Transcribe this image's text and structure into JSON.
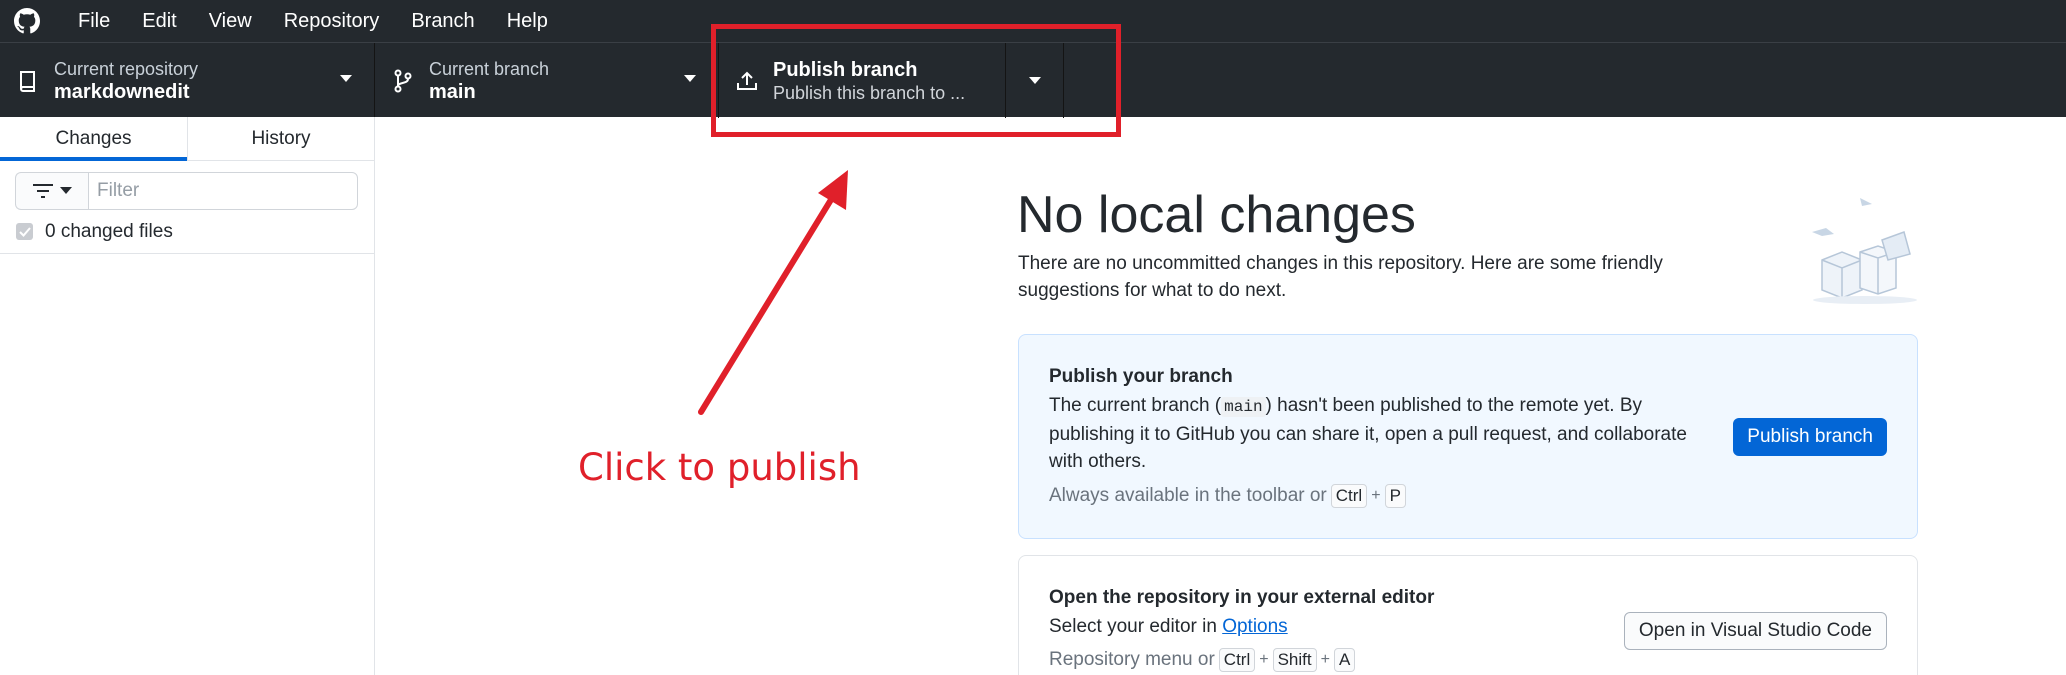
{
  "menu": {
    "items": [
      "File",
      "Edit",
      "View",
      "Repository",
      "Branch",
      "Help"
    ]
  },
  "toolbar": {
    "repo_label": "Current repository",
    "repo_value": "markdownedit",
    "branch_label": "Current branch",
    "branch_value": "main",
    "publish_title": "Publish branch",
    "publish_sub": "Publish this branch to ..."
  },
  "sidebar": {
    "tabs": [
      "Changes",
      "History"
    ],
    "filter_placeholder": "Filter",
    "changed_files": "0 changed files"
  },
  "main": {
    "title": "No local changes",
    "description": "There are no uncommitted changes in this repository. Here are some friendly suggestions for what to do next."
  },
  "publish_card": {
    "title": "Publish your branch",
    "body_before": "The current branch (",
    "branch_code": "main",
    "body_after": ") hasn't been published to the remote yet. By publishing it to GitHub you can share it, open a pull request, and collaborate with others.",
    "hint": "Always available in the toolbar or",
    "keys": [
      "Ctrl",
      "P"
    ],
    "button": "Publish branch"
  },
  "editor_card": {
    "title": "Open the repository in your external editor",
    "body": "Select your editor in",
    "link": "Options",
    "hint": "Repository menu or",
    "keys": [
      "Ctrl",
      "Shift",
      "A"
    ],
    "button": "Open in Visual Studio Code"
  },
  "annotation": {
    "text": "Click to publish",
    "color": "#e0202a"
  }
}
